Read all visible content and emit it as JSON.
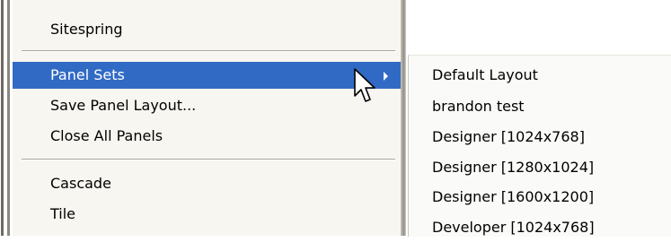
{
  "menu": {
    "items": [
      {
        "label": "Sitespring"
      },
      {
        "label": "Panel Sets"
      },
      {
        "label": "Save Panel Layout..."
      },
      {
        "label": "Close All Panels"
      },
      {
        "label": "Cascade"
      },
      {
        "label": "Tile"
      }
    ]
  },
  "submenu": {
    "items": [
      {
        "label": "Default Layout"
      },
      {
        "label": "brandon test"
      },
      {
        "label": "Designer [1024x768]"
      },
      {
        "label": "Designer [1280x1024]"
      },
      {
        "label": "Designer [1600x1200]"
      },
      {
        "label": "Developer [1024x768]"
      }
    ]
  },
  "colors": {
    "highlight": "#316ac5",
    "menu_background": "#f8f6f0"
  },
  "icons": {
    "submenu_indicator": "chevron-right-icon",
    "pointer": "mouse-cursor-icon"
  }
}
